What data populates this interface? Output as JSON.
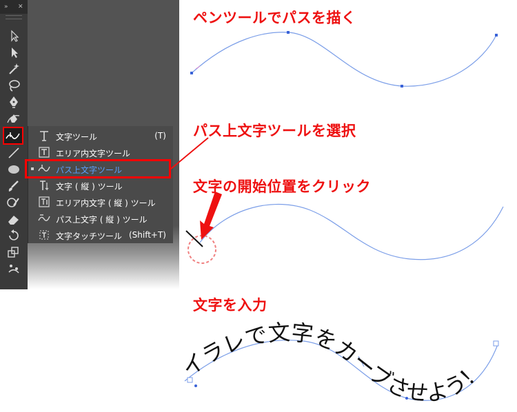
{
  "headings": {
    "step1": "ペンツールでパスを描く",
    "step2": "パス上文字ツールを選択",
    "step3": "文字の開始位置をクリック",
    "step4": "文字を入力"
  },
  "toolbar": {
    "expand_glyph": "»",
    "close_glyph": "✕"
  },
  "flyout": {
    "items": [
      {
        "label": "文字ツール",
        "shortcut": "(T)"
      },
      {
        "label": "エリア内文字ツール",
        "shortcut": ""
      },
      {
        "label": "パス上文字ツール",
        "shortcut": ""
      },
      {
        "label": "文字 ( 縦 ) ツール",
        "shortcut": ""
      },
      {
        "label": "エリア内文字 ( 縦 ) ツール",
        "shortcut": ""
      },
      {
        "label": "パス上文字 ( 縦 ) ツール",
        "shortcut": ""
      },
      {
        "label": "文字タッチツール",
        "shortcut": "(Shift+T)"
      }
    ]
  },
  "path_text": "イラレで文字をカーブさせよう！",
  "colors": {
    "accent_red": "#ee1111",
    "path_blue": "#7b9ee8",
    "active_blue": "#5aa0ff",
    "panel_dark": "#535353"
  }
}
